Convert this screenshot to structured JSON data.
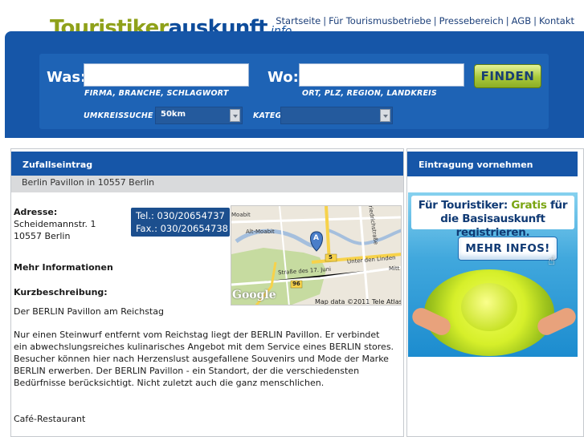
{
  "header": {
    "logo": {
      "part1": "Touristiker",
      "part2": "auskunft",
      "part3": ".info"
    },
    "nav": [
      "Startseite",
      "Für Tourismusbetriebe",
      "Pressebereich",
      "AGB",
      "Kontakt"
    ]
  },
  "search": {
    "was_label": "Was:",
    "was_value": "",
    "was_hint": "FIRMA, BRANCHE, SCHLAGWORT",
    "wo_label": "Wo:",
    "wo_value": "",
    "wo_hint": "ORT, PLZ, REGION, LANDKREIS",
    "button": "FINDEN",
    "radius_label": "UMKREISSUCHE",
    "radius_value": "50km",
    "category_label": "KATEGORIE",
    "category_value": ""
  },
  "random_entry": {
    "heading": "Zufallseintrag",
    "title": "Berlin Pavillon in 10557 Berlin",
    "address_label": "Adresse:",
    "street": "Scheidemannstr. 1",
    "city": "10557 Berlin",
    "phone": "Tel.: 030/20654737",
    "fax": "Fax.: 030/20654738",
    "more_info": "Mehr Informationen",
    "short_desc_label": "Kurzbeschreibung:",
    "desc_title": "Der BERLIN Pavillon am Reichstag",
    "desc_body": "Nur einen Steinwurf entfernt vom Reichstag liegt der BERLIN Pavillon. Er verbindet ein abwechslungsreiches kulinarisches Angebot mit dem Service eines BERLIN stores. Besucher können hier nach Herzenslust ausgefallene Souvenirs und Mode der Marke BERLIN erwerben. Der BERLIN Pavillon - ein Standort, der die verschiedensten Bedürfnisse berücksichtigt. Nicht zuletzt auch die ganz menschlichen.",
    "category": "Café-Restaurant"
  },
  "map": {
    "marker": "A",
    "labels": [
      "Moabit",
      "Alt-Moabit",
      "Straße des 17. Juni",
      "Unter den Linden",
      "Mitt",
      "Friedrichstraße",
      "5",
      "96"
    ],
    "credit": "Map data ©2011 Tele Atlas",
    "logo": "Google",
    "colors": {
      "land": "#ece7dc",
      "park": "#c6dba0",
      "water": "#a5bfdd",
      "major_road": "#f7d24a"
    }
  },
  "sidebar": {
    "heading": "Eintragung vornehmen",
    "promo_line1_prefix": "Für Touristiker: ",
    "promo_line1_highlight": "Gratis",
    "promo_line1_suffix": " für",
    "promo_line2": "die Basisauskunft registrieren.",
    "promo_button": "MEHR INFOS!"
  },
  "colors": {
    "brand_blue": "#1656a8",
    "brand_green": "#8fa11a",
    "subbar_grey": "#d9dadc"
  }
}
